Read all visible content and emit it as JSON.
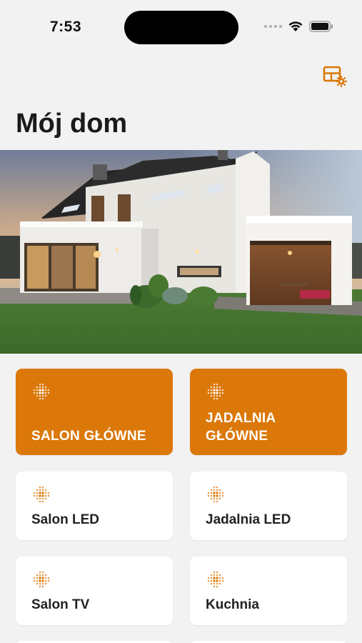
{
  "status_bar": {
    "time": "7:53"
  },
  "header": {
    "title": "Mój dom",
    "settings_icon": "layout-settings-icon"
  },
  "colors": {
    "accent": "#db7809",
    "background": "#f2f2f2",
    "card": "#ffffff"
  },
  "tiles": [
    {
      "label": "SALON GŁÓWNE",
      "active": true,
      "icon": "light-dots-icon"
    },
    {
      "label": "JADALNIA GŁÓWNE",
      "active": true,
      "icon": "light-dots-icon"
    },
    {
      "label": "Salon LED",
      "active": false,
      "icon": "light-dots-icon"
    },
    {
      "label": "Jadalnia LED",
      "active": false,
      "icon": "light-dots-icon"
    },
    {
      "label": "Salon TV",
      "active": false,
      "icon": "light-dots-icon"
    },
    {
      "label": "Kuchnia",
      "active": false,
      "icon": "light-dots-icon"
    }
  ]
}
